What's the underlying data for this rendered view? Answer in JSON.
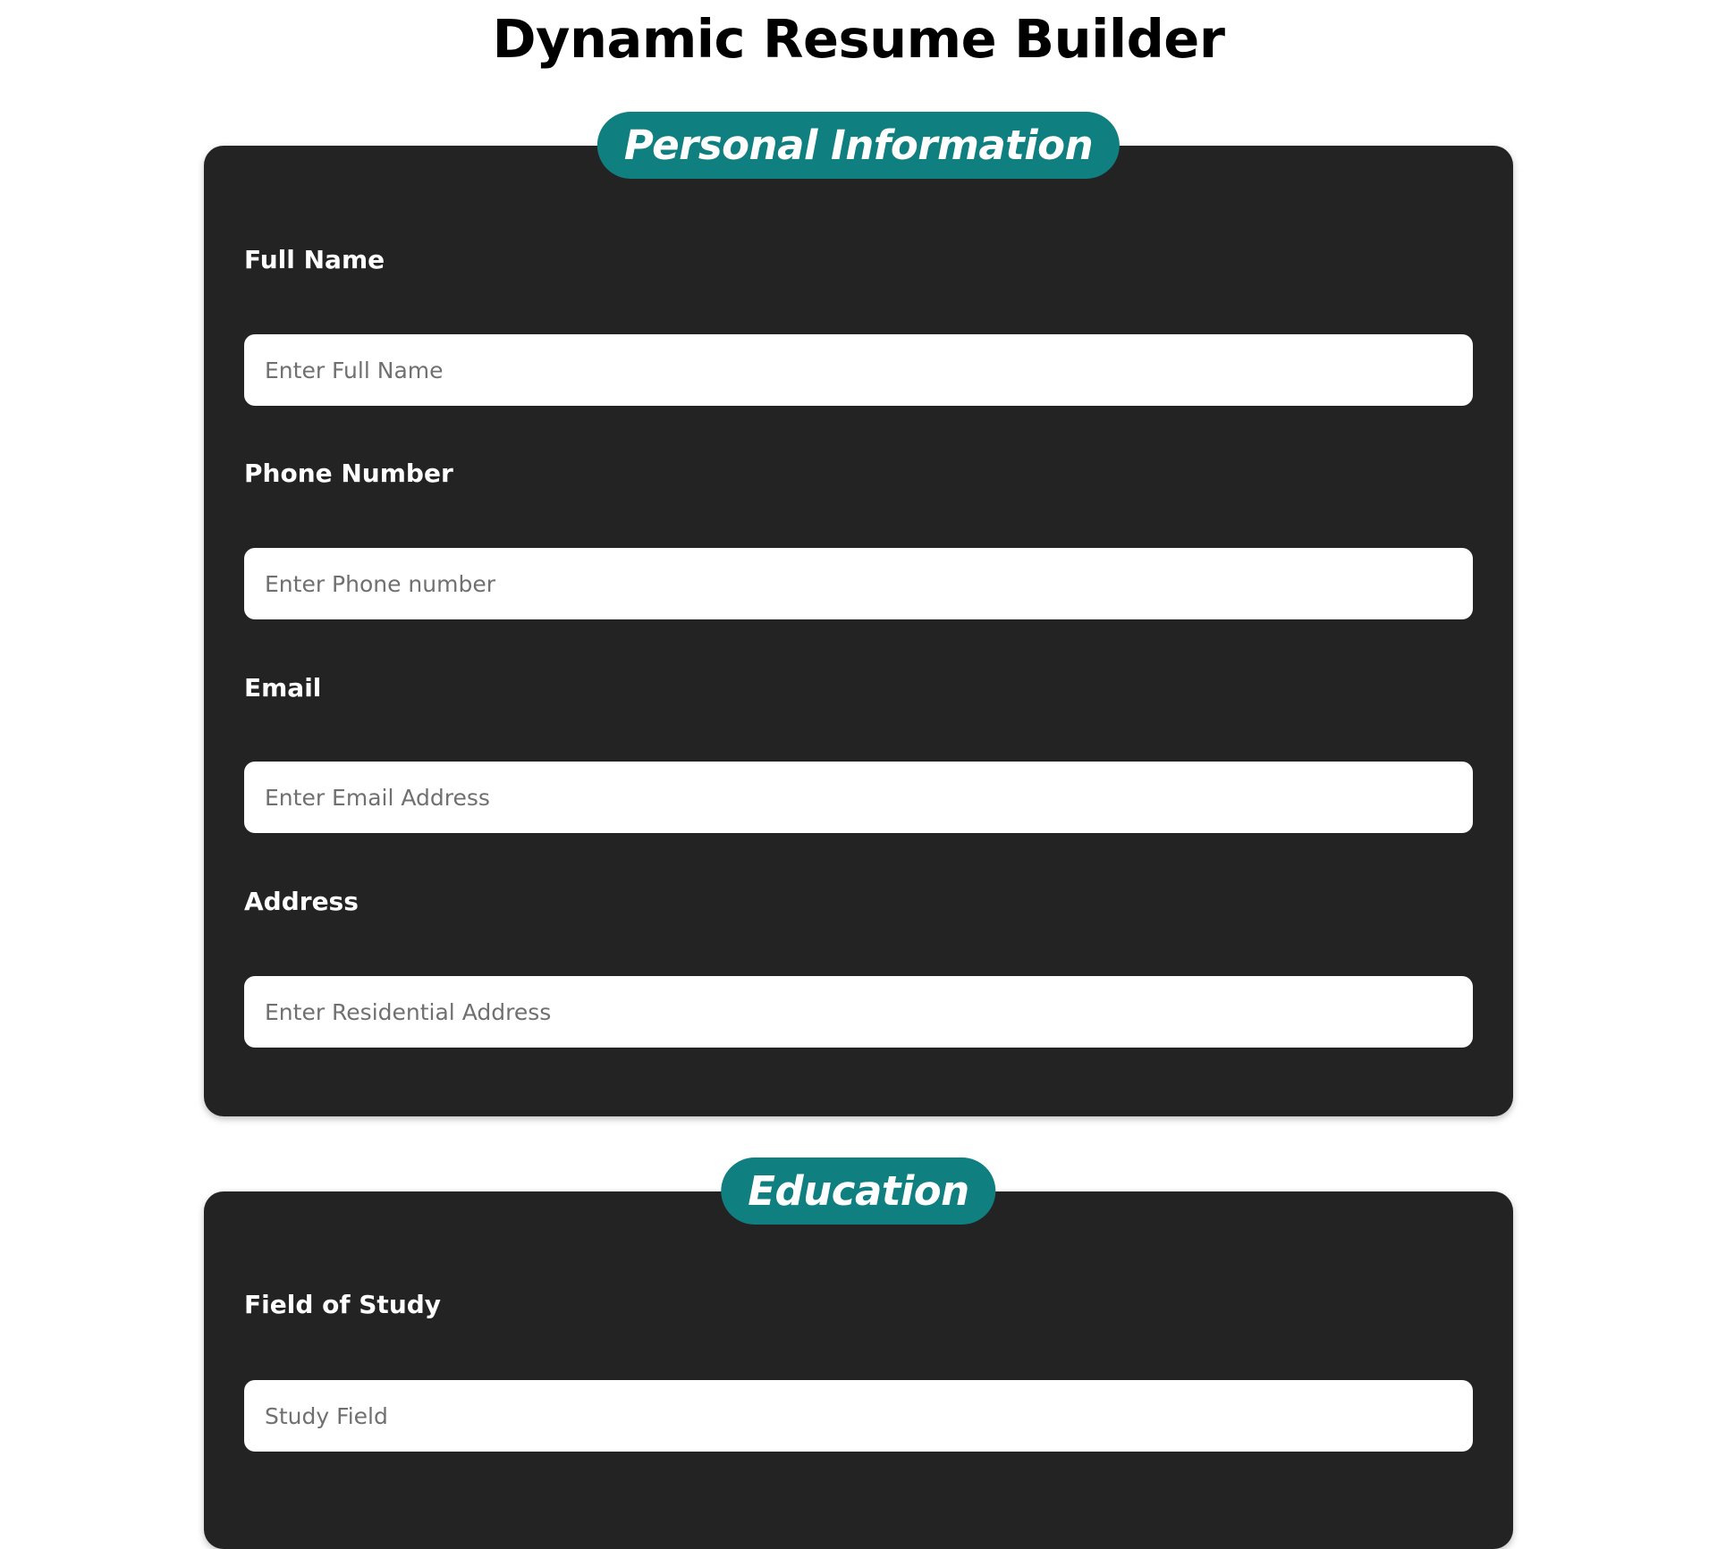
{
  "page": {
    "title": "Dynamic Resume Builder"
  },
  "colors": {
    "section_bg": "#232323",
    "badge_bg": "#0f7f80",
    "text_light": "#ffffff",
    "placeholder": "#707070"
  },
  "personal": {
    "title": "Personal Information",
    "fields": [
      {
        "label": "Full Name",
        "placeholder": "Enter Full Name",
        "value": ""
      },
      {
        "label": "Phone Number",
        "placeholder": "Enter Phone number",
        "value": ""
      },
      {
        "label": "Email",
        "placeholder": "Enter Email Address",
        "value": ""
      },
      {
        "label": "Address",
        "placeholder": "Enter Residential Address",
        "value": ""
      }
    ]
  },
  "education": {
    "title": "Education",
    "fields": [
      {
        "label": "Field of Study",
        "placeholder": "Study Field",
        "value": ""
      }
    ]
  }
}
